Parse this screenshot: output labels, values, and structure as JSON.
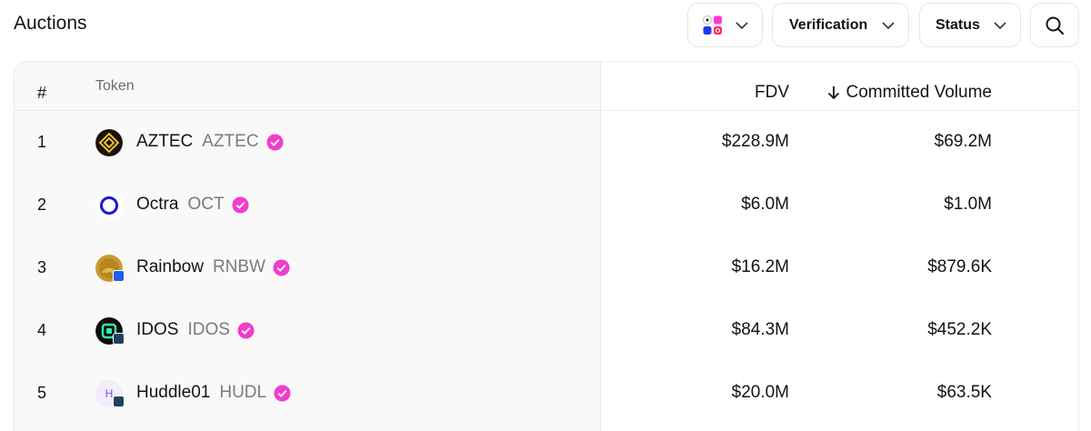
{
  "page": {
    "title": "Auctions"
  },
  "filters": {
    "chain_icon": "network-grid-icon",
    "verification_label": "Verification",
    "status_label": "Status",
    "search_icon": "search-icon"
  },
  "table": {
    "headers": {
      "rank": "#",
      "token": "Token",
      "fdv": "FDV",
      "volume": "Committed Volume"
    },
    "sort_icon": "arrow-down-icon",
    "rows": [
      {
        "rank": "1",
        "name": "AZTEC",
        "symbol": "AZTEC",
        "fdv": "$228.9M",
        "volume": "$69.2M",
        "logo": "aztec-logo-icon"
      },
      {
        "rank": "2",
        "name": "Octra",
        "symbol": "OCT",
        "fdv": "$6.0M",
        "volume": "$1.0M",
        "logo": "octra-logo-icon"
      },
      {
        "rank": "3",
        "name": "Rainbow",
        "symbol": "RNBW",
        "fdv": "$16.2M",
        "volume": "$879.6K",
        "logo": "rainbow-logo-icon"
      },
      {
        "rank": "4",
        "name": "IDOS",
        "symbol": "IDOS",
        "fdv": "$84.3M",
        "volume": "$452.2K",
        "logo": "idos-logo-icon"
      },
      {
        "rank": "5",
        "name": "Huddle01",
        "symbol": "HUDL",
        "fdv": "$20.0M",
        "volume": "$63.5K",
        "logo": "huddle01-logo-icon",
        "logo_letter": "H"
      }
    ]
  },
  "colors": {
    "verified_badge": "#f03dcd",
    "accent_pink": "#fc37d5"
  }
}
